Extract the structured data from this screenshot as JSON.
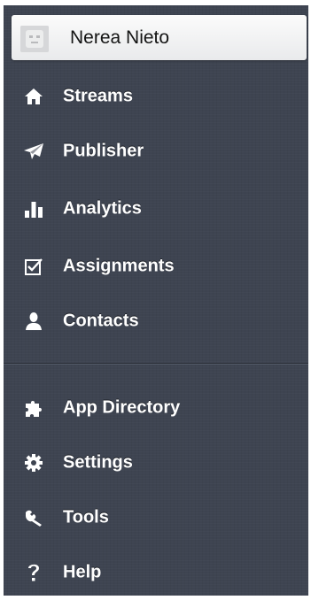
{
  "user": {
    "name": "Nerea Nieto",
    "avatar_icon": "avatar-placeholder-icon"
  },
  "menu": {
    "primary": [
      {
        "label": "Streams",
        "icon": "home-icon"
      },
      {
        "label": "Publisher",
        "icon": "paper-plane-icon"
      },
      {
        "label": "Analytics",
        "icon": "bar-chart-icon"
      },
      {
        "label": "Assignments",
        "icon": "checkbox-icon"
      },
      {
        "label": "Contacts",
        "icon": "person-icon"
      }
    ],
    "secondary": [
      {
        "label": "App Directory",
        "icon": "puzzle-icon"
      },
      {
        "label": "Settings",
        "icon": "gear-icon"
      },
      {
        "label": "Tools",
        "icon": "wrench-icon"
      },
      {
        "label": "Help",
        "icon": "question-icon"
      }
    ]
  },
  "colors": {
    "sidebar_bg": "#3e4451",
    "text": "#ffffff",
    "user_row_bg": "#f4f4f5"
  }
}
